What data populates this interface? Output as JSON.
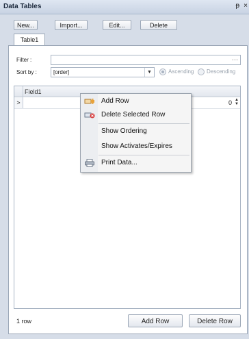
{
  "window": {
    "title": "Data Tables",
    "pin_glyph": "ᵽ",
    "close_glyph": "×"
  },
  "toolbar": {
    "new_label": "New...",
    "import_label": "Import...",
    "edit_label": "Edit...",
    "delete_label": "Delete"
  },
  "tabs": [
    {
      "label": "Table1"
    }
  ],
  "filter": {
    "label": "Filter :",
    "value": "",
    "browse_label": "···"
  },
  "sort": {
    "label": "Sort by :",
    "value": "[order]",
    "ascending_label": "Ascending",
    "descending_label": "Descending"
  },
  "grid": {
    "columns": [
      "Field1"
    ],
    "rows": [
      {
        "indicator": ">",
        "value": "0"
      }
    ]
  },
  "context_menu": {
    "items": [
      {
        "label": "Add Row",
        "icon": "add-row-icon"
      },
      {
        "label": "Delete Selected Row",
        "icon": "delete-row-icon"
      },
      {
        "label": "Show Ordering",
        "icon": ""
      },
      {
        "label": "Show Activates/Expires",
        "icon": ""
      },
      {
        "label": "Print Data...",
        "icon": "printer-icon"
      }
    ]
  },
  "footer": {
    "row_count": "1 row",
    "add_row_label": "Add Row",
    "delete_row_label": "Delete Row"
  },
  "colors": {
    "panel_bg": "#d6dde8",
    "titlebar_text": "#1d2a3d",
    "menu_bg": "#f5f5f5"
  }
}
